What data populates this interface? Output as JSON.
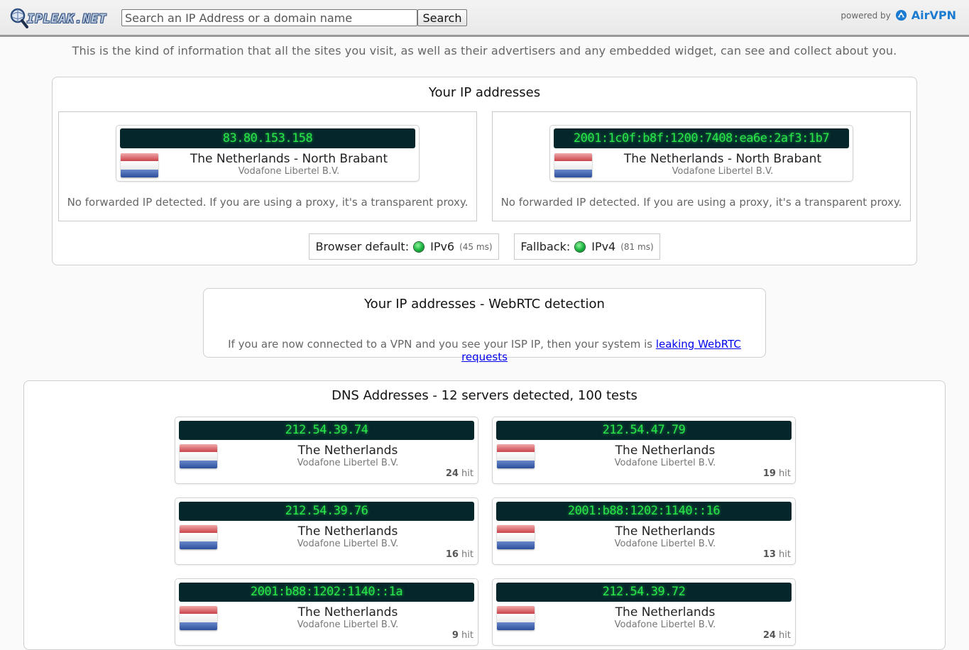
{
  "header": {
    "logo_text": "IPLEAK.NET",
    "search_placeholder": "Search an IP Address or a domain name",
    "search_button": "Search",
    "powered_by": "powered by",
    "sponsor": "AirVPN"
  },
  "intro": "This is the kind of information that all the sites you visit, as well as their advertisers and any embedded widget, can see and collect about you.",
  "ip_section": {
    "title": "Your IP addresses",
    "addresses": [
      {
        "ip": "83.80.153.158",
        "country": "The Netherlands - North Brabant",
        "isp": "Vodafone Libertel B.V.",
        "forwarded": "No forwarded IP detected. If you are using a proxy, it's a transparent proxy."
      },
      {
        "ip": "2001:1c0f:b8f:1200:7408:ea6e:2af3:1b7",
        "country": "The Netherlands - North Brabant",
        "isp": "Vodafone Libertel B.V.",
        "forwarded": "No forwarded IP detected. If you are using a proxy, it's a transparent proxy."
      }
    ],
    "browser_default": {
      "label": "Browser default:",
      "protocol": "IPv6",
      "latency": "(45 ms)"
    },
    "fallback": {
      "label": "Fallback:",
      "protocol": "IPv4",
      "latency": "(81 ms)"
    }
  },
  "webrtc": {
    "title": "Your IP addresses - WebRTC detection",
    "note": "If you are now connected to a VPN and you see your ISP IP, then your system is ",
    "link": "leaking WebRTC requests"
  },
  "dns": {
    "title": "DNS Addresses - 12 servers detected, 100 tests",
    "hit_suffix": "hit",
    "servers": [
      {
        "ip": "212.54.39.74",
        "country": "The Netherlands",
        "isp": "Vodafone Libertel B.V.",
        "hits": "24"
      },
      {
        "ip": "212.54.47.79",
        "country": "The Netherlands",
        "isp": "Vodafone Libertel B.V.",
        "hits": "19"
      },
      {
        "ip": "212.54.39.76",
        "country": "The Netherlands",
        "isp": "Vodafone Libertel B.V.",
        "hits": "16"
      },
      {
        "ip": "2001:b88:1202:1140::16",
        "country": "The Netherlands",
        "isp": "Vodafone Libertel B.V.",
        "hits": "13"
      },
      {
        "ip": "2001:b88:1202:1140::1a",
        "country": "The Netherlands",
        "isp": "Vodafone Libertel B.V.",
        "hits": "9"
      },
      {
        "ip": "212.54.39.72",
        "country": "The Netherlands",
        "isp": "Vodafone Libertel B.V.",
        "hits": "24"
      }
    ]
  },
  "colors": {
    "ip_bar_bg": "#05262a",
    "ip_text": "#29e64a",
    "link": "#0000ee",
    "sponsor": "#1a7bd1"
  }
}
